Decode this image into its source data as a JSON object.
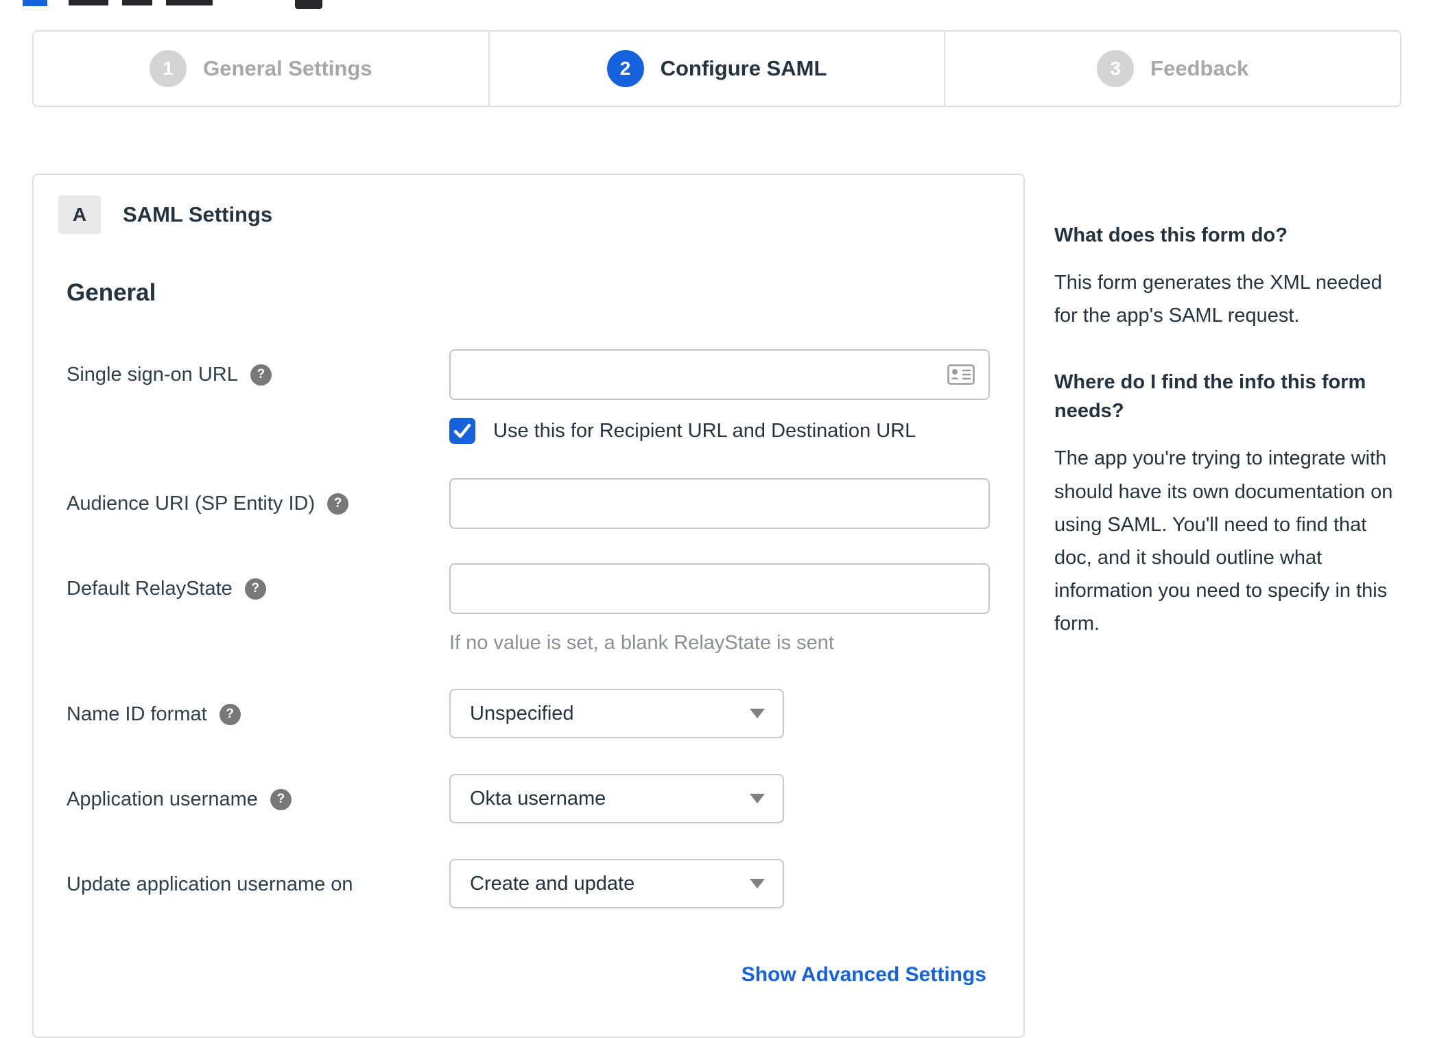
{
  "ui": {
    "help_glyph": "?"
  },
  "colors": {
    "accent_blue": "#1662dd",
    "inactive_gray": "#a8a8a8",
    "border_gray": "#dedede",
    "text_dark": "#24333f",
    "hint_gray": "#8d8d97"
  },
  "stepper": {
    "steps": [
      {
        "number": "1",
        "label": "General Settings",
        "active": false
      },
      {
        "number": "2",
        "label": "Configure SAML",
        "active": true
      },
      {
        "number": "3",
        "label": "Feedback",
        "active": false
      }
    ]
  },
  "panel": {
    "badge": "A",
    "title": "SAML Settings",
    "section_heading": "General",
    "advanced_link": "Show Advanced Settings"
  },
  "form": {
    "sso": {
      "label": "Single sign-on URL",
      "value": "",
      "checkbox_label": "Use this for Recipient URL and Destination URL",
      "checked": true
    },
    "audience": {
      "label": "Audience URI (SP Entity ID)",
      "value": ""
    },
    "relay": {
      "label": "Default RelayState",
      "value": "",
      "hint": "If no value is set, a blank RelayState is sent"
    },
    "nameid": {
      "label": "Name ID format",
      "value": "Unspecified"
    },
    "appuser": {
      "label": "Application username",
      "value": "Okta username"
    },
    "update_on": {
      "label": "Update application username on",
      "value": "Create and update"
    }
  },
  "sidebar": {
    "q1": "What does this form do?",
    "a1": "This form generates the XML needed for the app's SAML request.",
    "q2": "Where do I find the info this form needs?",
    "a2": "The app you're trying to integrate with should have its own documentation on using SAML. You'll need to find that doc, and it should outline what information you need to specify in this form."
  }
}
